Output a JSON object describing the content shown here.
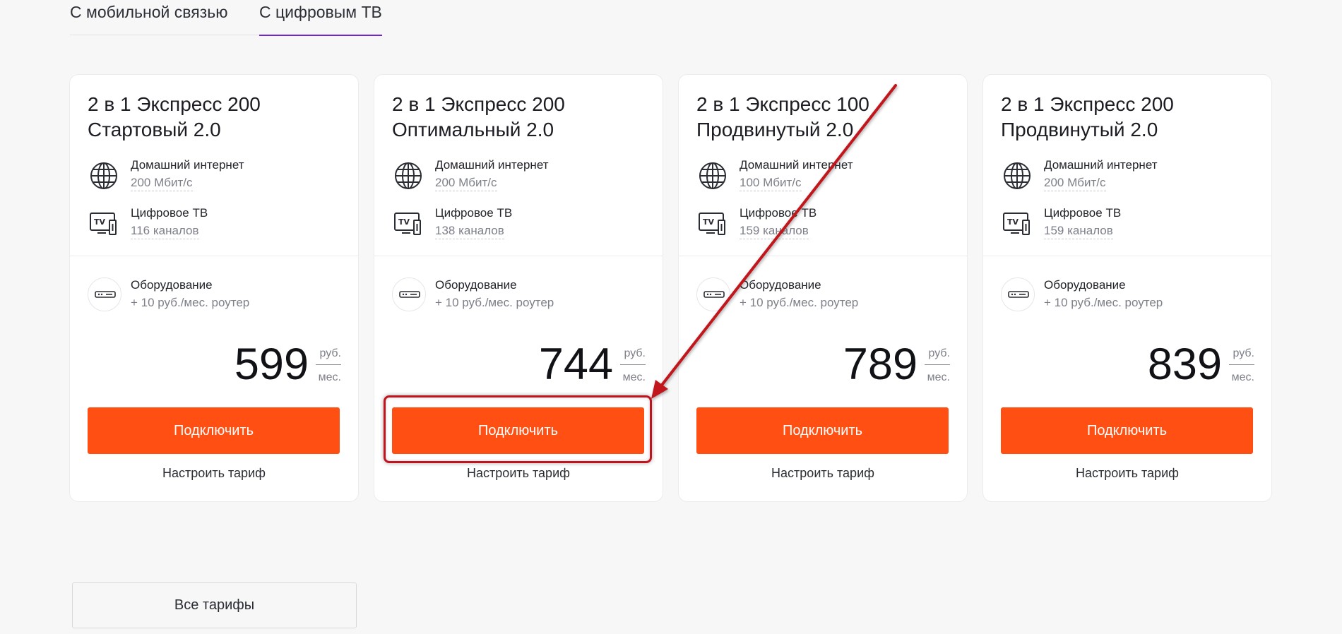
{
  "tabs": [
    {
      "label": "С мобильной связью",
      "active": false
    },
    {
      "label": "С цифровым ТВ",
      "active": true
    }
  ],
  "accent_colors": {
    "tab_underline": "#7525d1",
    "button": "#ff4f12",
    "annotation": "#c0141f"
  },
  "cards": [
    {
      "title_line1": "2 в 1 Экспресс 200",
      "title_line2": "Стартовый 2.0",
      "internet_label": "Домашний интернет",
      "internet_value": "200 Мбит/с",
      "tv_label": "Цифровое ТВ",
      "tv_value": "116 каналов",
      "equipment_label": "Оборудование",
      "equipment_value": "+ 10 руб./мес. роутер",
      "price": "599",
      "unit_top": "руб.",
      "unit_bottom": "мес.",
      "connect_label": "Подключить",
      "tune_label": "Настроить тариф"
    },
    {
      "title_line1": "2 в 1 Экспресс 200",
      "title_line2": "Оптимальный 2.0",
      "internet_label": "Домашний интернет",
      "internet_value": "200 Мбит/с",
      "tv_label": "Цифровое ТВ",
      "tv_value": "138 каналов",
      "equipment_label": "Оборудование",
      "equipment_value": "+ 10 руб./мес. роутер",
      "price": "744",
      "unit_top": "руб.",
      "unit_bottom": "мес.",
      "connect_label": "Подключить",
      "tune_label": "Настроить тариф"
    },
    {
      "title_line1": "2 в 1 Экспресс 100",
      "title_line2": "Продвинутый 2.0",
      "internet_label": "Домашний интернет",
      "internet_value": "100 Мбит/с",
      "tv_label": "Цифровое ТВ",
      "tv_value": "159 каналов",
      "equipment_label": "Оборудование",
      "equipment_value": "+ 10 руб./мес. роутер",
      "price": "789",
      "unit_top": "руб.",
      "unit_bottom": "мес.",
      "connect_label": "Подключить",
      "tune_label": "Настроить тариф"
    },
    {
      "title_line1": "2 в 1 Экспресс 200",
      "title_line2": "Продвинутый 2.0",
      "internet_label": "Домашний интернет",
      "internet_value": "200 Мбит/с",
      "tv_label": "Цифровое ТВ",
      "tv_value": "159 каналов",
      "equipment_label": "Оборудование",
      "equipment_value": "+ 10 руб./мес. роутер",
      "price": "839",
      "unit_top": "руб.",
      "unit_bottom": "мес.",
      "connect_label": "Подключить",
      "tune_label": "Настроить тариф"
    }
  ],
  "icons": {
    "internet": "globe-icon",
    "tv": "tv-icon",
    "equipment": "router-icon"
  },
  "all_tariffs_label": "Все тарифы"
}
